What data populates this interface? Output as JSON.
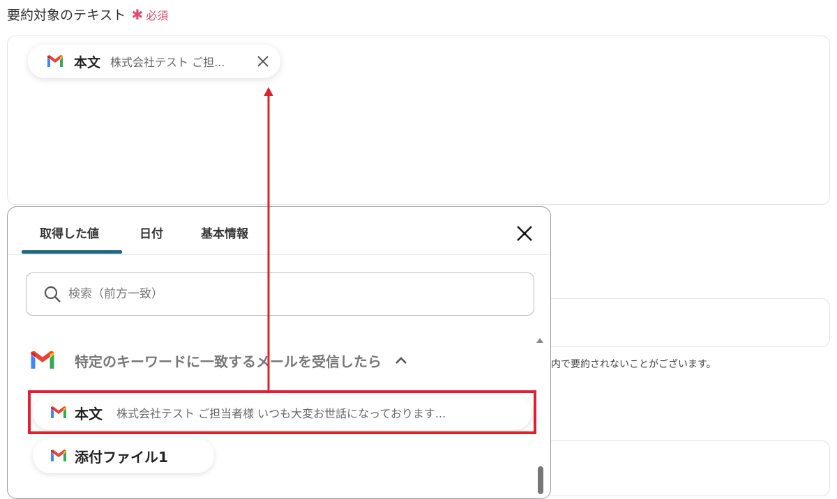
{
  "field": {
    "label": "要約対象のテキスト",
    "required_label": "必須"
  },
  "chip": {
    "key": "本文",
    "value": "株式会社テスト ご担..."
  },
  "background": {
    "hint_text": "内で要約されないことがございます。"
  },
  "popup": {
    "tabs": [
      "取得した値",
      "日付",
      "基本情報"
    ],
    "active_tab": 0,
    "search_placeholder": "検索（前方一致）",
    "group_title": "特定のキーワードに一致するメールを受信したら",
    "items": [
      {
        "key": "本文",
        "value": "株式会社テスト ご担当者様 いつも大変お世話になっております..."
      },
      {
        "key": "添付ファイル1",
        "value": ""
      }
    ]
  },
  "colors": {
    "required": "#e54a6a",
    "tab_accent": "#1e6b7d",
    "highlight": "#e0202d"
  },
  "icons": [
    "gmail-icon",
    "close-icon",
    "search-icon",
    "chevron-up-icon"
  ]
}
